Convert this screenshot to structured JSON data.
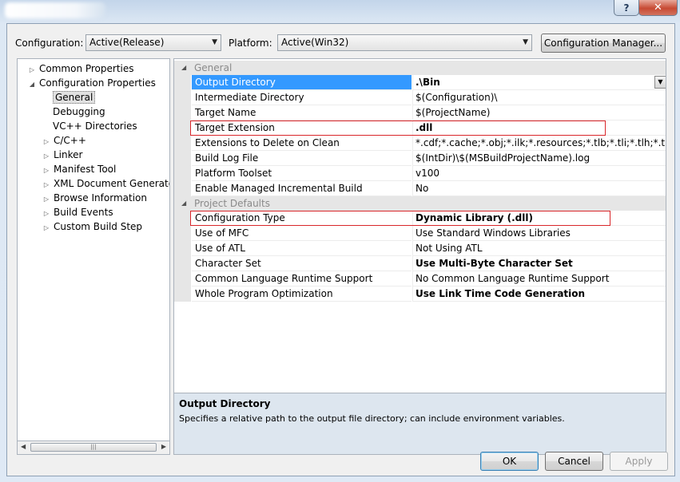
{
  "window": {
    "title": "",
    "help_label": "?",
    "close_label": "✕"
  },
  "toolbar": {
    "configuration_label": "Configuration:",
    "configuration_value": "Active(Release)",
    "platform_label": "Platform:",
    "platform_value": "Active(Win32)",
    "config_manager_label": "Configuration Manager...",
    "dropdown_icon": "chevron-down-icon"
  },
  "tree": {
    "items": [
      {
        "label": "Common Properties",
        "expander": "▷"
      },
      {
        "label": "Configuration Properties",
        "expander": "◢"
      },
      {
        "label": "General",
        "expander": ""
      },
      {
        "label": "Debugging",
        "expander": ""
      },
      {
        "label": "VC++ Directories",
        "expander": ""
      },
      {
        "label": "C/C++",
        "expander": "▷"
      },
      {
        "label": "Linker",
        "expander": "▷"
      },
      {
        "label": "Manifest Tool",
        "expander": "▷"
      },
      {
        "label": "XML Document Generator",
        "expander": "▷"
      },
      {
        "label": "Browse Information",
        "expander": "▷"
      },
      {
        "label": "Build Events",
        "expander": "▷"
      },
      {
        "label": "Custom Build Step",
        "expander": "▷"
      }
    ],
    "selected_index": 2,
    "scroll_left": "◀",
    "scroll_right": "▶",
    "scroll_grip": "|||"
  },
  "grid": {
    "categories": [
      {
        "label": "General",
        "expander": "◢"
      },
      {
        "label": "Project Defaults",
        "expander": "◢"
      }
    ],
    "general_rows": [
      {
        "name": "Output Directory",
        "value": ".\\Bin",
        "bold": true
      },
      {
        "name": "Intermediate Directory",
        "value": "$(Configuration)\\",
        "bold": false
      },
      {
        "name": "Target Name",
        "value": "$(ProjectName)",
        "bold": false
      },
      {
        "name": "Target Extension",
        "value": ".dll",
        "bold": true
      },
      {
        "name": "Extensions to Delete on Clean",
        "value": "*.cdf;*.cache;*.obj;*.ilk;*.resources;*.tlb;*.tli;*.tlh;*.tmp;*.rsp;*",
        "bold": false
      },
      {
        "name": "Build Log File",
        "value": "$(IntDir)\\$(MSBuildProjectName).log",
        "bold": false
      },
      {
        "name": "Platform Toolset",
        "value": "v100",
        "bold": false
      },
      {
        "name": "Enable Managed Incremental Build",
        "value": "No",
        "bold": false
      }
    ],
    "defaults_rows": [
      {
        "name": "Configuration Type",
        "value": "Dynamic Library (.dll)",
        "bold": true
      },
      {
        "name": "Use of MFC",
        "value": "Use Standard Windows Libraries",
        "bold": false
      },
      {
        "name": "Use of ATL",
        "value": "Not Using ATL",
        "bold": false
      },
      {
        "name": "Character Set",
        "value": "Use Multi-Byte Character Set",
        "bold": true
      },
      {
        "name": "Common Language Runtime Support",
        "value": "No Common Language Runtime Support",
        "bold": false
      },
      {
        "name": "Whole Program Optimization",
        "value": "Use Link Time Code Generation",
        "bold": true
      }
    ],
    "selected_row": "Output Directory",
    "highlighted_rows": [
      "Target Extension",
      "Configuration Type"
    ],
    "highlight_color": "#d9262a",
    "selection_color": "#3399ff"
  },
  "description": {
    "title": "Output Directory",
    "text": "Specifies a relative path to the output file directory; can include environment variables."
  },
  "buttons": {
    "ok_label": "OK",
    "cancel_label": "Cancel",
    "apply_label": "Apply"
  }
}
